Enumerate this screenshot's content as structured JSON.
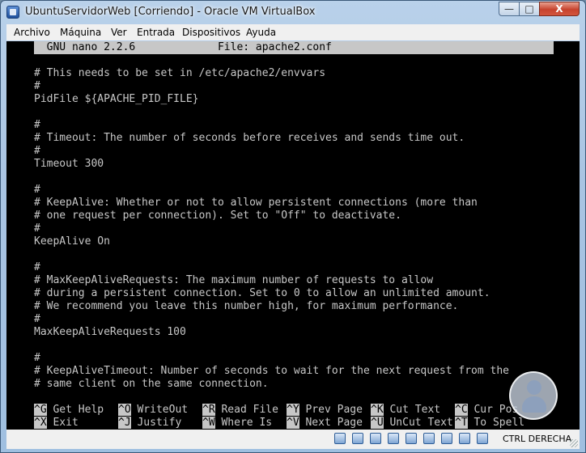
{
  "window": {
    "title": "UbuntuServidorWeb [Corriendo] - Oracle VM VirtualBox"
  },
  "window_controls": {
    "minimize": "—",
    "maximize": "□",
    "close": "X"
  },
  "menu": [
    "Archivo",
    "Máquina",
    "Ver",
    "Entrada",
    "Dispositivos",
    "Ayuda"
  ],
  "nano": {
    "header": "  GNU nano 2.2.6             File: apache2.conf",
    "lines": [
      "",
      "# This needs to be set in /etc/apache2/envvars",
      "#",
      "PidFile ${APACHE_PID_FILE}",
      "",
      "#",
      "# Timeout: The number of seconds before receives and sends time out.",
      "#",
      "Timeout 300",
      "",
      "#",
      "# KeepAlive: Whether or not to allow persistent connections (more than",
      "# one request per connection). Set to \"Off\" to deactivate.",
      "#",
      "KeepAlive On",
      "",
      "#",
      "# MaxKeepAliveRequests: The maximum number of requests to allow",
      "# during a persistent connection. Set to 0 to allow an unlimited amount.",
      "# We recommend you leave this number high, for maximum performance.",
      "#",
      "MaxKeepAliveRequests 100",
      "",
      "#",
      "# KeepAliveTimeout: Number of seconds to wait for the next request from the",
      "# same client on the same connection."
    ],
    "shortcuts_row1": [
      {
        "key": "^G",
        "label": " Get Help"
      },
      {
        "key": "^O",
        "label": " WriteOut"
      },
      {
        "key": "^R",
        "label": " Read File"
      },
      {
        "key": "^Y",
        "label": " Prev Page"
      },
      {
        "key": "^K",
        "label": " Cut Text"
      },
      {
        "key": "^C",
        "label": " Cur Pos"
      }
    ],
    "shortcuts_row2": [
      {
        "key": "^X",
        "label": " Exit"
      },
      {
        "key": "^J",
        "label": " Justify"
      },
      {
        "key": "^W",
        "label": " Where Is"
      },
      {
        "key": "^V",
        "label": " Next Page"
      },
      {
        "key": "^U",
        "label": " UnCut Text"
      },
      {
        "key": "^T",
        "label": " To Spell"
      }
    ]
  },
  "status": {
    "host_key": "CTRL DERECHA"
  }
}
